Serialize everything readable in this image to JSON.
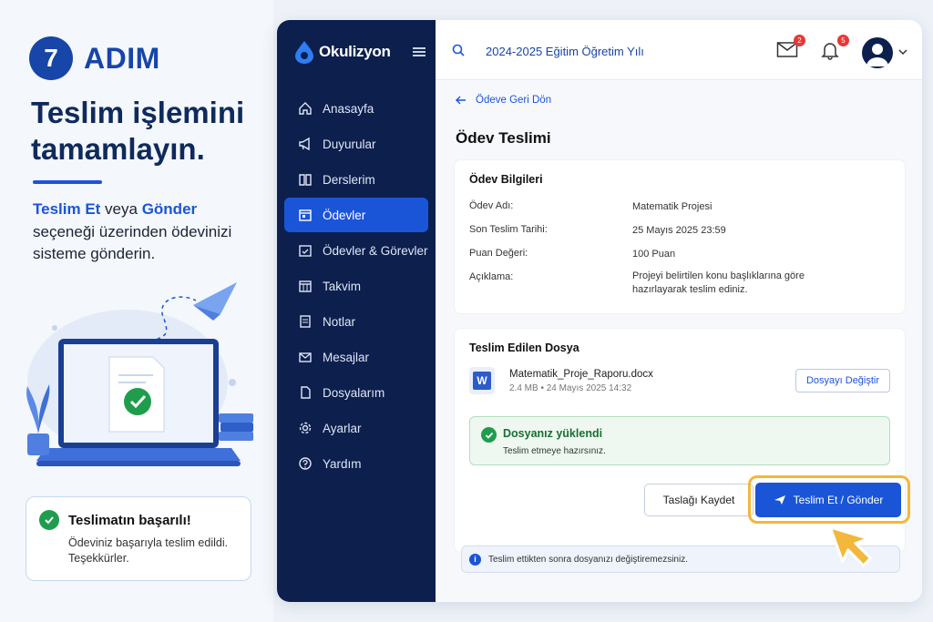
{
  "tutorial": {
    "step_number": "7",
    "step_word": "ADIM",
    "headline": "Teslim işlemini tamamlayın.",
    "desc_hl1": "Teslim Et",
    "desc_mid": " veya ",
    "desc_hl2": "Gönder",
    "desc_rest": " seçeneği üzerinden ödevinizi sisteme gönderin.",
    "success_title": "Teslimatın başarılı!",
    "success_text": "Ödeviniz başarıyla teslim edildi. Teşekkürler."
  },
  "app": {
    "logo": "Okulizyon",
    "year": "2024-2025 Eğitim Öğretim Yılı",
    "mail_count": "2",
    "bell_count": "5",
    "nav": [
      {
        "label": "Anasayfa",
        "icon": "home-icon"
      },
      {
        "label": "Duyurular",
        "icon": "megaphone-icon"
      },
      {
        "label": "Derslerim",
        "icon": "book-icon"
      },
      {
        "label": "Ödevler",
        "icon": "calendar-icon",
        "active": true
      },
      {
        "label": "Ödevler & Görevler",
        "icon": "tasks-calendar-icon"
      },
      {
        "label": "Takvim",
        "icon": "calendar-grid-icon"
      },
      {
        "label": "Notlar",
        "icon": "notes-icon"
      },
      {
        "label": "Mesajlar",
        "icon": "mail-icon"
      },
      {
        "label": "Dosyalarım",
        "icon": "file-icon"
      },
      {
        "label": "Ayarlar",
        "icon": "gear-icon"
      },
      {
        "label": "Yardım",
        "icon": "help-icon"
      }
    ],
    "back_label": "Ödeve Geri Dön",
    "page_title": "Ödev Teslimi",
    "info_card": {
      "title": "Ödev Bilgileri",
      "rows": [
        {
          "label": "Ödev Adı:",
          "value": "Matematik Projesi"
        },
        {
          "label": "Son Teslim Tarihi:",
          "value": "25 Mayıs 2025 23:59"
        },
        {
          "label": "Puan Değeri:",
          "value": "100 Puan"
        },
        {
          "label": "Açıklama:",
          "value": "Projeyi belirtilen konu başlıklarına göre hazırlayarak teslim ediniz."
        }
      ]
    },
    "file_card": {
      "title": "Teslim Edilen Dosya",
      "file_icon_letter": "W",
      "file_name": "Matematik_Proje_Raporu.docx",
      "file_meta": "2.4 MB • 24 Mayıs 2025 14:32",
      "change_label": "Dosyayı Değiştir",
      "uploaded_title": "Dosyanız yüklendi",
      "uploaded_text": "Teslim etmeye hazırsınız.",
      "draft_label": "Taslağı Kaydet",
      "submit_label": "Teslim Et / Gönder"
    },
    "note": "Teslim ettikten sonra dosyanızı değiştiremezsiniz.",
    "info_glyph": "i"
  }
}
